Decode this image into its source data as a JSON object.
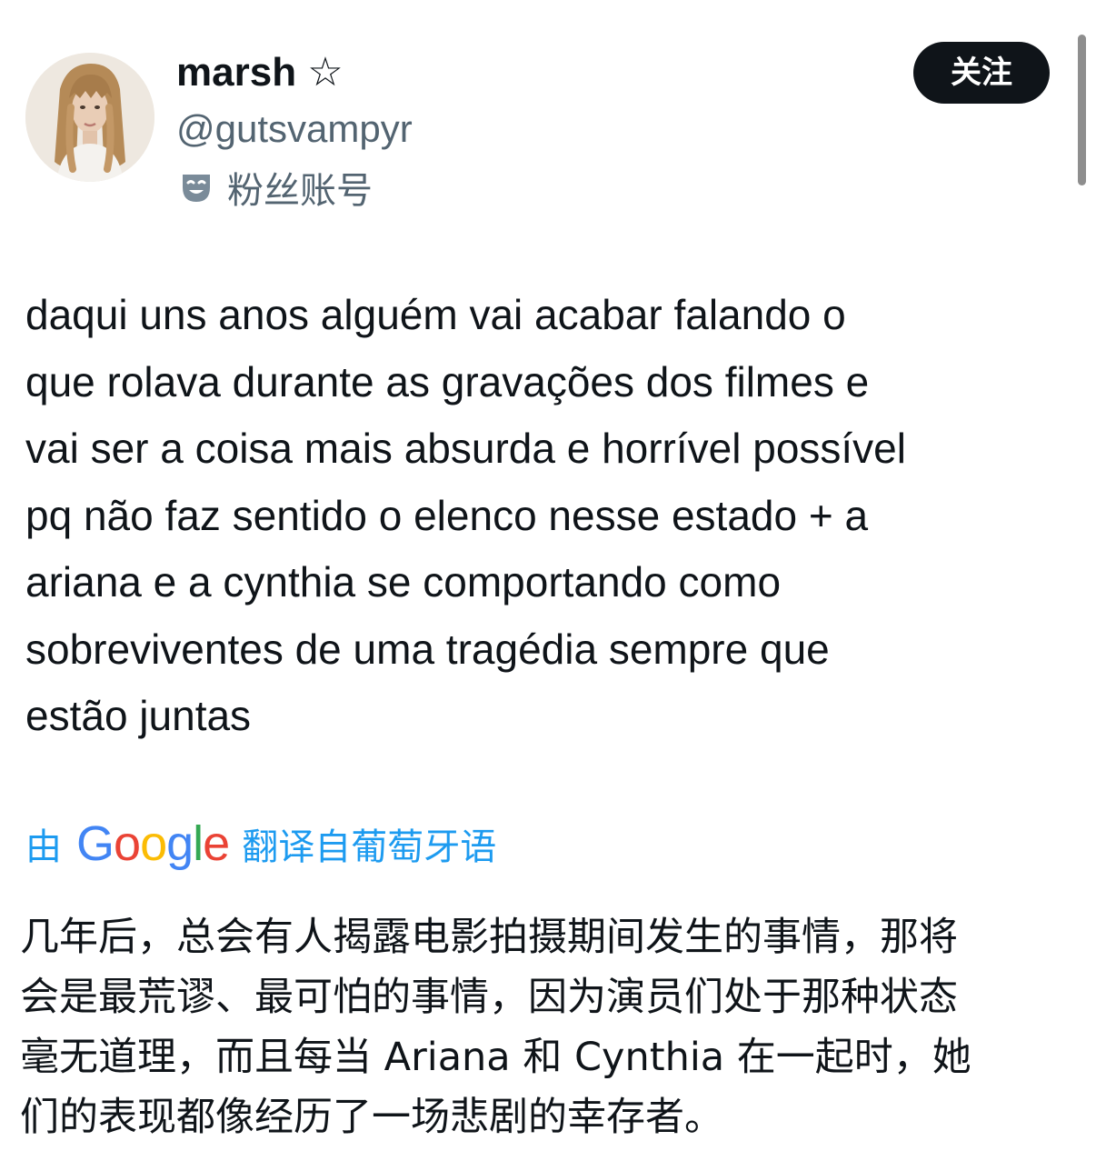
{
  "user": {
    "display_name": "marsh ☆",
    "handle": "@gutsvampyr",
    "badge_icon": "theater-mask-icon",
    "badge_label": "粉丝账号",
    "avatar": "avatar-photo"
  },
  "follow_button": {
    "label": "关注"
  },
  "tweet": {
    "lines": [
      "daqui uns anos alguém vai acabar falando o",
      "que rolava durante as gravações dos filmes e",
      "vai ser a coisa mais absurda e horrível possível",
      "pq não faz sentido o elenco nesse estado + a",
      "ariana e a cynthia se comportando como",
      "sobreviventes de uma tragédia sempre que",
      "estão juntas"
    ]
  },
  "translation": {
    "prefix": "由",
    "provider_letters": [
      "G",
      "o",
      "o",
      "g",
      "l",
      "e"
    ],
    "suffix": "翻译自葡萄牙语",
    "link_color": "#1d9bf0",
    "lines": [
      "几年后，总会有人揭露电影拍摄期间发生的事情，那将",
      "会是最荒谬、最可怕的事情，因为演员们处于那种状态",
      "毫无道理，而且每当 Ariana 和 Cynthia 在一起时，她",
      "们的表现都像经历了一场悲剧的幸存者。"
    ]
  },
  "colors": {
    "text_primary": "#0f1419",
    "text_secondary": "#536471",
    "button_bg": "#0f1419",
    "google_blue": "#4285f4",
    "google_red": "#ea4335",
    "google_yellow": "#fbbc05",
    "google_green": "#34a853"
  }
}
